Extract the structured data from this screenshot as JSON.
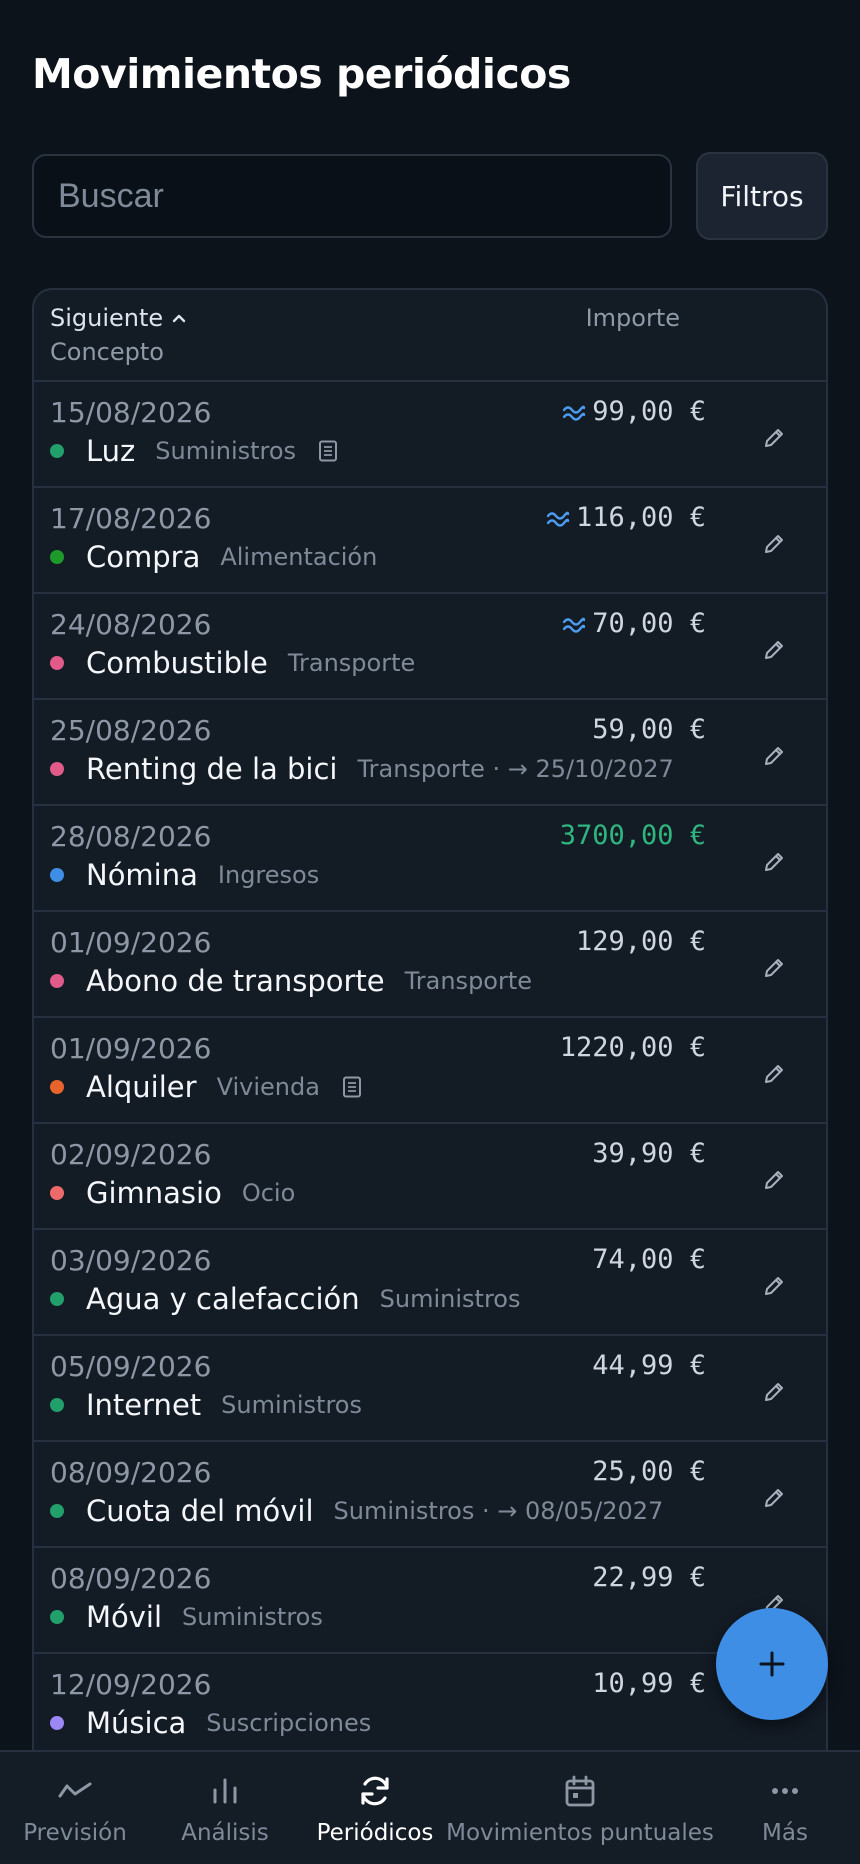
{
  "header": {
    "title": "Movimientos periódicos"
  },
  "search": {
    "placeholder": "Buscar",
    "value": ""
  },
  "filters_label": "Filtros",
  "table": {
    "sort_label": "Siguiente",
    "concept_label": "Concepto",
    "amount_label": "Importe"
  },
  "colors": {
    "background": "#0d131b",
    "accent": "#3f8ee6",
    "income": "#2fb67e"
  },
  "rows": [
    {
      "date": "15/08/2026",
      "name": "Luz",
      "category": "Suministros",
      "amount": "99,00 €",
      "variable": true,
      "note": true,
      "income": false,
      "dot": "#22a06b"
    },
    {
      "date": "17/08/2026",
      "name": "Compra",
      "category": "Alimentación",
      "amount": "116,00 €",
      "variable": true,
      "note": false,
      "income": false,
      "dot": "#1d9a2a"
    },
    {
      "date": "24/08/2026",
      "name": "Combustible",
      "category": "Transporte",
      "amount": "70,00 €",
      "variable": true,
      "note": false,
      "income": false,
      "dot": "#e05a8a"
    },
    {
      "date": "25/08/2026",
      "name": "Renting de la bici",
      "category": "Transporte · → 25/10/2027",
      "amount": "59,00 €",
      "variable": false,
      "note": false,
      "income": false,
      "dot": "#e05a8a"
    },
    {
      "date": "28/08/2026",
      "name": "Nómina",
      "category": "Ingresos",
      "amount": "3700,00 €",
      "variable": false,
      "note": false,
      "income": true,
      "dot": "#3f8ee6"
    },
    {
      "date": "01/09/2026",
      "name": "Abono de transporte",
      "category": "Transporte",
      "amount": "129,00 €",
      "variable": false,
      "note": false,
      "income": false,
      "dot": "#e05a8a"
    },
    {
      "date": "01/09/2026",
      "name": "Alquiler",
      "category": "Vivienda",
      "amount": "1220,00 €",
      "variable": false,
      "note": true,
      "income": false,
      "dot": "#e8642c"
    },
    {
      "date": "02/09/2026",
      "name": "Gimnasio",
      "category": "Ocio",
      "amount": "39,90 €",
      "variable": false,
      "note": false,
      "income": false,
      "dot": "#ec6a6a"
    },
    {
      "date": "03/09/2026",
      "name": "Agua y calefacción",
      "category": "Suministros",
      "amount": "74,00 €",
      "variable": false,
      "note": false,
      "income": false,
      "dot": "#22a06b"
    },
    {
      "date": "05/09/2026",
      "name": "Internet",
      "category": "Suministros",
      "amount": "44,99 €",
      "variable": false,
      "note": false,
      "income": false,
      "dot": "#22a06b"
    },
    {
      "date": "08/09/2026",
      "name": "Cuota del móvil",
      "category": "Suministros · → 08/05/2027",
      "amount": "25,00 €",
      "variable": false,
      "note": false,
      "income": false,
      "dot": "#22a06b"
    },
    {
      "date": "08/09/2026",
      "name": "Móvil",
      "category": "Suministros",
      "amount": "22,99 €",
      "variable": false,
      "note": false,
      "income": false,
      "dot": "#22a06b"
    },
    {
      "date": "12/09/2026",
      "name": "Música",
      "category": "Suscripciones",
      "amount": "10,99 €",
      "variable": false,
      "note": false,
      "income": false,
      "dot": "#9b87f5"
    }
  ],
  "nav": [
    {
      "label": "Previsión",
      "icon": "trend-icon",
      "active": false
    },
    {
      "label": "Análisis",
      "icon": "bar-chart-icon",
      "active": false
    },
    {
      "label": "Periódicos",
      "icon": "refresh-icon",
      "active": true
    },
    {
      "label": "Movimientos puntuales",
      "icon": "calendar-icon",
      "active": false
    },
    {
      "label": "Más",
      "icon": "more-icon",
      "active": false
    }
  ]
}
